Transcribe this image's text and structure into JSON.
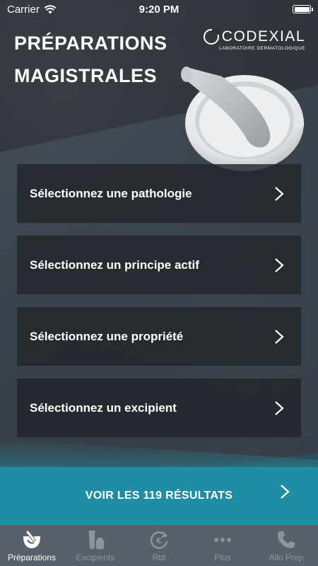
{
  "status_bar": {
    "carrier": "Carrier",
    "time": "9:20 PM"
  },
  "header": {
    "title_line1": "PRÉPARATIONS",
    "title_line2": "MAGISTRALES"
  },
  "logo": {
    "name": "CODEXIAL",
    "tagline": "LABORATOIRE DERMATOLOGIQUE"
  },
  "menu": {
    "items": [
      {
        "label": "Sélectionnez une pathologie"
      },
      {
        "label": "Sélectionnez un principe actif"
      },
      {
        "label": "Sélectionnez une propriété"
      },
      {
        "label": "Sélectionnez un excipient"
      }
    ]
  },
  "results_button": {
    "label": "VOIR LES 119 RÉSULTATS"
  },
  "tabbar": {
    "active_index": 0,
    "tabs": [
      {
        "label": "Préparations",
        "icon": "mortar-icon"
      },
      {
        "label": "Excipients",
        "icon": "tube-icon"
      },
      {
        "label": "Rbt",
        "icon": "refresh-euro-icon"
      },
      {
        "label": "Plus",
        "icon": "more-icon"
      },
      {
        "label": "Allo Prep",
        "icon": "phone-icon"
      }
    ]
  },
  "colors": {
    "accent": "#1f8ea5",
    "tabbar_bg": "#58616a",
    "tab_inactive": "#8c949c",
    "card_bg": "#22262b"
  }
}
